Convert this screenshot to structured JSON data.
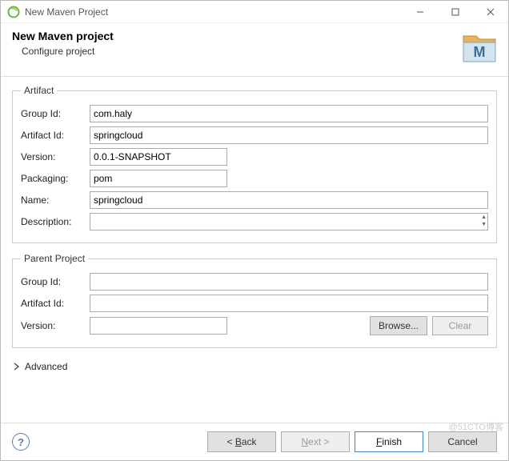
{
  "window": {
    "title": "New Maven Project"
  },
  "header": {
    "title": "New Maven project",
    "subtitle": "Configure project"
  },
  "artifact": {
    "legend": "Artifact",
    "groupIdLabel": "Group Id:",
    "groupId": "com.haly",
    "artifactIdLabel": "Artifact Id:",
    "artifactId": "springcloud",
    "versionLabel": "Version:",
    "version": "0.0.1-SNAPSHOT",
    "packagingLabel": "Packaging:",
    "packaging": "pom",
    "nameLabel": "Name:",
    "name": "springcloud",
    "descriptionLabel": "Description:",
    "description": ""
  },
  "parent": {
    "legend": "Parent Project",
    "groupIdLabel": "Group Id:",
    "groupId": "",
    "artifactIdLabel": "Artifact Id:",
    "artifactId": "",
    "versionLabel": "Version:",
    "version": "",
    "browse": "Browse...",
    "clear": "Clear"
  },
  "advanced": {
    "label": "Advanced"
  },
  "footer": {
    "back": "< Back",
    "next": "Next >",
    "finish": "Finish",
    "cancel": "Cancel"
  },
  "watermark": "@51CTO博客"
}
